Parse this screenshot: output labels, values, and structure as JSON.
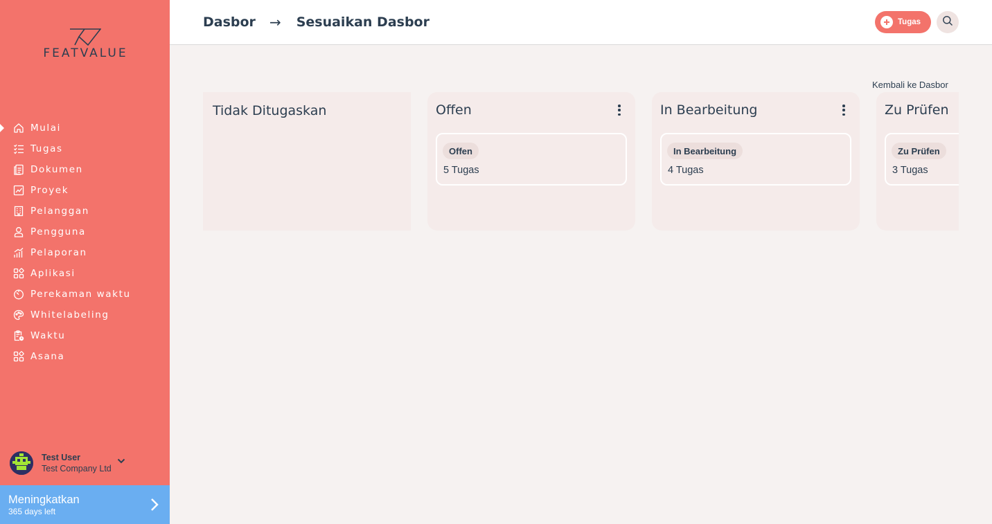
{
  "brand": {
    "name": "FEATVALUE"
  },
  "sidebar": {
    "items": [
      {
        "label": "Mulai",
        "icon": "home-icon",
        "active": true
      },
      {
        "label": "Tugas",
        "icon": "checklist-icon"
      },
      {
        "label": "Dokumen",
        "icon": "document-icon"
      },
      {
        "label": "Proyek",
        "icon": "chart-icon"
      },
      {
        "label": "Pelanggan",
        "icon": "building-icon"
      },
      {
        "label": "Pengguna",
        "icon": "user-icon"
      },
      {
        "label": "Pelaporan",
        "icon": "bar-chart-icon"
      },
      {
        "label": "Aplikasi",
        "icon": "apps-icon"
      },
      {
        "label": "Perekaman waktu",
        "icon": "timer-icon"
      },
      {
        "label": "Whitelabeling",
        "icon": "palette-icon"
      },
      {
        "label": "Waktu",
        "icon": "clipboard-clock-icon"
      },
      {
        "label": "Asana",
        "icon": "apps-icon"
      }
    ],
    "user": {
      "name": "Test User",
      "company": "Test Company Ltd"
    },
    "upgrade": {
      "title": "Meningkatkan",
      "subtitle": "365 days left"
    }
  },
  "header": {
    "breadcrumb": {
      "root": "Dasbor",
      "separator": "→",
      "current": "Sesuaikan Dasbor"
    },
    "task_button": "Tugas"
  },
  "main": {
    "back_link": "Kembali ke Dasbor",
    "columns": [
      {
        "title": "Tidak Ditugaskan"
      },
      {
        "title": "Offen",
        "card": {
          "badge": "Offen",
          "count": "5 Tugas"
        }
      },
      {
        "title": "In Bearbeitung",
        "card": {
          "badge": "In Bearbeitung",
          "count": "4 Tugas"
        }
      },
      {
        "title": "Zu Prüfen",
        "card": {
          "badge": "Zu Prüfen",
          "count": "3 Tugas"
        }
      }
    ]
  },
  "colors": {
    "sidebar": "#f3736b",
    "accent": "#f3736b",
    "upgrade": "#6aaef1",
    "text": "#2c3e50",
    "background": "#f6f2f1",
    "column": "#f5ebea"
  }
}
